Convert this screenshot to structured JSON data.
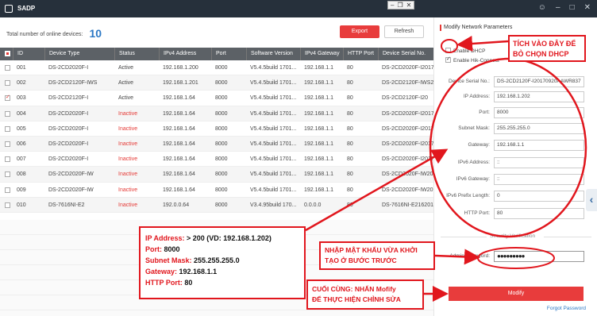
{
  "app": {
    "title": "SADP"
  },
  "summary": {
    "label": "Total number of online devices:",
    "count": "10"
  },
  "toolbar": {
    "export_label": "Export",
    "refresh_label": "Refresh"
  },
  "table": {
    "headers": [
      "ID",
      "Device Type",
      "Status",
      "IPv4 Address",
      "Port",
      "Software Version",
      "IPv4 Gateway",
      "HTTP Port",
      "Device Serial No."
    ],
    "rows": [
      {
        "id": "001",
        "type": "DS-2CD2020F-I",
        "status": "Active",
        "ip": "192.168.1.200",
        "port": "8000",
        "sw": "V5.4.5build 1701...",
        "gw": "192.168.1.1",
        "http": "80",
        "serial": "DS-2CD2020F-I2017",
        "checked": false,
        "inactive": false
      },
      {
        "id": "002",
        "type": "DS-2CD2120F-IWS",
        "status": "Active",
        "ip": "192.168.1.201",
        "port": "8000",
        "sw": "V5.4.5build 1701...",
        "gw": "192.168.1.1",
        "http": "80",
        "serial": "DS-2CD2120F-IWS2",
        "checked": false,
        "inactive": false
      },
      {
        "id": "003",
        "type": "DS-2CD2120F-I",
        "status": "Active",
        "ip": "192.168.1.64",
        "port": "8000",
        "sw": "V5.4.5build 1701...",
        "gw": "192.168.1.1",
        "http": "80",
        "serial": "DS-2CD2120F-I20",
        "checked": true,
        "inactive": false
      },
      {
        "id": "004",
        "type": "DS-2CD2020F-I",
        "status": "Inactive",
        "ip": "192.168.1.64",
        "port": "8000",
        "sw": "V5.4.5build 1701...",
        "gw": "192.168.1.1",
        "http": "80",
        "serial": "DS-2CD2020F-I2017",
        "checked": false,
        "inactive": true
      },
      {
        "id": "005",
        "type": "DS-2CD2020F-I",
        "status": "Inactive",
        "ip": "192.168.1.64",
        "port": "8000",
        "sw": "V5.4.5build 1701...",
        "gw": "192.168.1.1",
        "http": "80",
        "serial": "DS-2CD2020F-I2017",
        "checked": false,
        "inactive": true
      },
      {
        "id": "006",
        "type": "DS-2CD2020F-I",
        "status": "Inactive",
        "ip": "192.168.1.64",
        "port": "8000",
        "sw": "V5.4.5build 1701...",
        "gw": "192.168.1.1",
        "http": "80",
        "serial": "DS-2CD2020F-I2017",
        "checked": false,
        "inactive": true
      },
      {
        "id": "007",
        "type": "DS-2CD2020F-I",
        "status": "Inactive",
        "ip": "192.168.1.64",
        "port": "8000",
        "sw": "V5.4.5build 1701...",
        "gw": "192.168.1.1",
        "http": "80",
        "serial": "DS-2CD2020F-I2017",
        "checked": false,
        "inactive": true
      },
      {
        "id": "008",
        "type": "DS-2CD2020F-IW",
        "status": "Inactive",
        "ip": "192.168.1.64",
        "port": "8000",
        "sw": "V5.4.5build 1701...",
        "gw": "192.168.1.1",
        "http": "80",
        "serial": "DS-2CD2020F-IW20",
        "checked": false,
        "inactive": true
      },
      {
        "id": "009",
        "type": "DS-2CD2020F-IW",
        "status": "Inactive",
        "ip": "192.168.1.64",
        "port": "8000",
        "sw": "V5.4.5build 1701...",
        "gw": "192.168.1.1",
        "http": "80",
        "serial": "DS-2CD2020F-IW20",
        "checked": false,
        "inactive": true
      },
      {
        "id": "010",
        "type": "DS-7616NI-E2",
        "status": "Inactive",
        "ip": "192.0.0.64",
        "port": "8000",
        "sw": "V3.4.95build 170...",
        "gw": "0.0.0.0",
        "http": "80",
        "serial": "DS-7616NI-E216201",
        "checked": false,
        "inactive": true
      }
    ]
  },
  "panel": {
    "title": "Modify Network Parameters",
    "enable_dhcp": "Enable DHCP",
    "enable_hik": "Enable Hik-Connect",
    "fields": [
      {
        "label": "Device Serial No.:",
        "value": "DS-2CD2120F-I20170920AAWR837"
      },
      {
        "label": "IP Address:",
        "value": "192.168.1.202"
      },
      {
        "label": "Port:",
        "value": "8000"
      },
      {
        "label": "Subnet Mask:",
        "value": "255.255.255.0"
      },
      {
        "label": "Gateway:",
        "value": "192.168.1.1"
      },
      {
        "label": "IPv6 Address:",
        "value": "::"
      },
      {
        "label": "IPv6 Gateway:",
        "value": "::"
      },
      {
        "label": "IPv6 Prefix Length:",
        "value": "0"
      },
      {
        "label": "HTTP Port:",
        "value": "80"
      }
    ],
    "security_label": "Security Verification",
    "admin_label": "Admin Password:",
    "admin_value": "●●●●●●●●●",
    "modify_label": "Modify",
    "forgot_label": "Forgot Password"
  },
  "annotations": {
    "dhcp_note_1": "TÍCH VÀO ĐÂY ĐỂ",
    "dhcp_note_2": "BỎ CHỌN DHCP",
    "pwd_note_1": "NHẬP MẬT KHẨU VỪA KHỞI",
    "pwd_note_2": "TẠO Ở BƯỚC TRƯỚC",
    "final_note_1": "CUỐI CÙNG: NHẤN Mofify",
    "final_note_2": "ĐỂ THỰC HIỆN CHỈNH SỬA",
    "main_note": [
      {
        "k": "IP Address:",
        "v": " > 200 (VD: 192.168.1.202)"
      },
      {
        "k": "Port:",
        "v": " 8000"
      },
      {
        "k": "Subnet Mask:",
        "v": " 255.255.255.0"
      },
      {
        "k": "Gateway:",
        "v": " 192.168.1.1"
      },
      {
        "k": "HTTP Port:",
        "v": " 80"
      }
    ]
  },
  "colors": {
    "accent": "#e83c3c",
    "annotation": "#e1161d",
    "titlebar": "#26303b",
    "link": "#2b78c5"
  },
  "icons": {
    "logo": "sadp-logo-icon",
    "minimize": "minimize-icon",
    "maximize": "maximize-icon",
    "close": "close-icon",
    "collapse": "chevron-left-icon"
  }
}
